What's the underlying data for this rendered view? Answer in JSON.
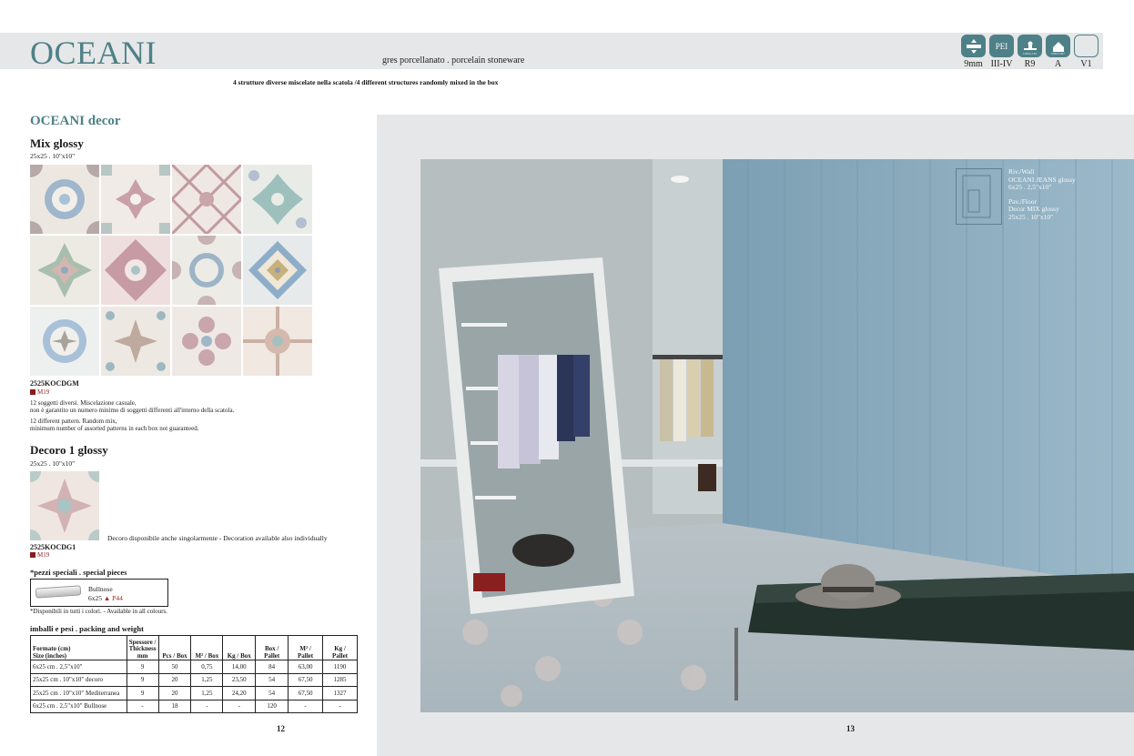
{
  "header": {
    "title": "OCEANI",
    "subtitle": "gres porcellanato . porcelain stoneware",
    "note": "4 strutture diverse miscelate nella scatola /4 different structures randomly mixed in the box",
    "badges": [
      {
        "icon": "thickness-icon",
        "label": "9mm"
      },
      {
        "icon": "pei-icon",
        "text": "PEI",
        "label": "III-IV"
      },
      {
        "icon": "slip-resistance-icon",
        "label": "R9"
      },
      {
        "icon": "chemical-resistance-icon",
        "label": "A"
      },
      {
        "icon": "shade-variation-icon",
        "label": "V1"
      }
    ],
    "accent_color": "#4e8087"
  },
  "left": {
    "section_title": "OCEANI decor",
    "mix": {
      "heading": "Mix glossy",
      "size": "25x25 . 10\"x10\"",
      "code": "2525KOCDGM",
      "m_code": "M19",
      "note_it_1": "12 soggetti diversi. Miscelazione casuale,",
      "note_it_2": "non è garantito un numero minimo di soggetti differenti all'interno della scatola.",
      "note_en_1": "12 different pattern. Random mix,",
      "note_en_2": "minimum number of assorted patterns in each box not guaranteed."
    },
    "decoro": {
      "heading": "Decoro 1 glossy",
      "size": "25x25 . 10\"x10\"",
      "availability": "Decoro disponibile anche singolarmente - Decoration available also individually",
      "code": "2525KOCDG1",
      "m_code": "M19"
    },
    "special": {
      "heading": "*pezzi speciali . special pieces",
      "name": "Bullnose",
      "size": "6x25",
      "ref": "▲ P44",
      "available": "*Disponibili in tutti i colori. - Available in all colours."
    },
    "packing": {
      "heading": "imballi e pesi . packing and weight",
      "headers": [
        "Formato (cm)",
        "Size (inches)",
        "Spessore /",
        "Thickness",
        "mm",
        "Pcs / Box",
        "M² / Box",
        "Kg / Box",
        "Box /",
        "Pallet",
        "M² /",
        "Pallet",
        "Kg /",
        "Pallet"
      ],
      "rows": [
        [
          "6x25 cm . 2,5\"x10\"",
          "9",
          "50",
          "0,75",
          "14,00",
          "84",
          "63,00",
          "1190"
        ],
        [
          "25x25 cm . 10\"x10\" decoro",
          "9",
          "20",
          "1,25",
          "23,50",
          "54",
          "67,50",
          "1285"
        ],
        [
          "25x25 cm . 10\"x10\" Mediterranea",
          "9",
          "20",
          "1,25",
          "24,20",
          "54",
          "67,50",
          "1327"
        ],
        [
          "6x25 cm . 2,5\"x10\" Bullnose",
          "-",
          "18",
          "-",
          "-",
          "120",
          "-",
          "-"
        ]
      ]
    },
    "page_number": "12"
  },
  "right": {
    "legend": {
      "wall_label": "Riv./Wall",
      "wall_product": "OCEANI JEANS glossy",
      "wall_size": "6x25 . 2,5\"x10\"",
      "floor_label": "Pav./Floor",
      "floor_product": "Decor MIX glossy",
      "floor_size": "25x25 . 10\"x10\""
    },
    "page_number": "13"
  }
}
